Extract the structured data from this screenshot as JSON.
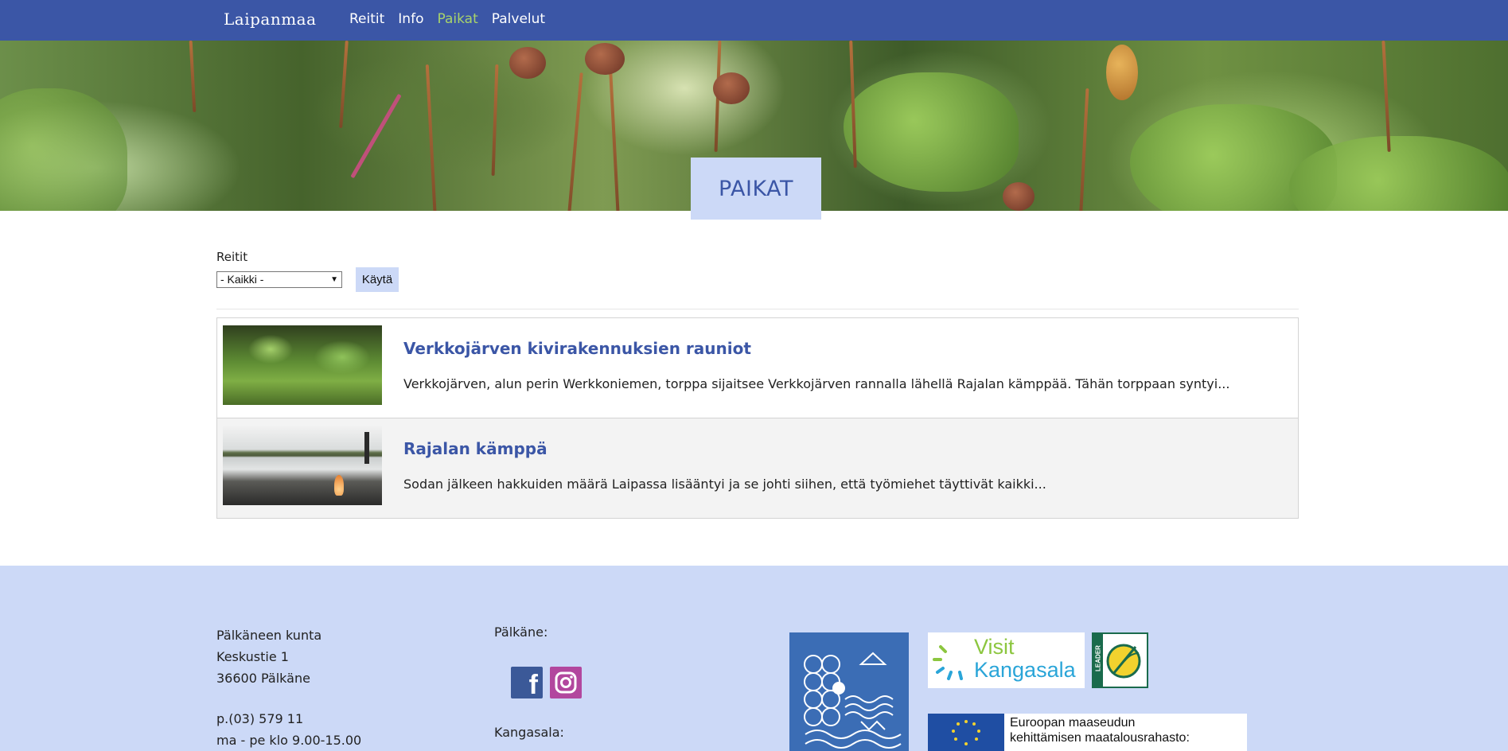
{
  "nav": {
    "brand": "Laipanmaa",
    "items": [
      {
        "label": "Reitit",
        "active": false
      },
      {
        "label": "Info",
        "active": false
      },
      {
        "label": "Paikat",
        "active": true
      },
      {
        "label": "Palvelut",
        "active": false
      }
    ]
  },
  "hero": {
    "title": "PAIKAT"
  },
  "filter": {
    "label": "Reitit",
    "selected": "- Kaikki -",
    "apply_label": "Käytä"
  },
  "places": [
    {
      "title": "Verkkojärven kivirakennuksien rauniot",
      "excerpt": "Verkkojärven, alun perin Werkkoniemen, torppa sijaitsee Verkkojärven rannalla lähellä Rajalan kämppää. Tähän torppaan syntyi..."
    },
    {
      "title": "Rajalan kämppä",
      "excerpt": "Sodan jälkeen hakkuiden määrä Laipassa lisääntyi ja se johti siihen, että työmiehet täyttivät kaikki..."
    }
  ],
  "footer": {
    "address": {
      "name": "Pälkäneen kunta",
      "street": "Keskustie 1",
      "city": "36600 Pälkäne",
      "phone": "p.(03) 579 11",
      "hours": "ma - pe klo 9.00-15.00"
    },
    "palkane_label": "Pälkäne:",
    "kangasala_label": "Kangasala:",
    "social": [
      "facebook-icon",
      "instagram-icon"
    ],
    "visit_logo": {
      "word1": "Visit",
      "word2": "Kangasala"
    },
    "leader_logo": "LEADER",
    "eu_text": {
      "line1": "Euroopan maaseudun",
      "line2": "kehittämisen maatalousrahasto:"
    }
  },
  "colors": {
    "nav_bg": "#3b56a6",
    "active_nav": "#a8d36b",
    "accent_light": "#ccd9f7",
    "link": "#3b56a6"
  }
}
